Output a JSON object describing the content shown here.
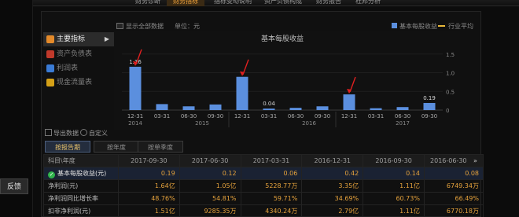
{
  "topnav": {
    "items": [
      "财务诊断",
      "财务指标",
      "指标变动说明",
      "资产负债构成",
      "财务报告",
      "杜邦分析"
    ],
    "active_index": 1
  },
  "feedback_label": "反馈",
  "sidebar": {
    "items": [
      {
        "label": "主要指标",
        "icon": "gear-icon",
        "color": "#e48a2a"
      },
      {
        "label": "资产负债表",
        "icon": "table-icon",
        "color": "#c0392b"
      },
      {
        "label": "利润表",
        "icon": "pie-icon",
        "color": "#3a7bd5"
      },
      {
        "label": "现金流量表",
        "icon": "cash-icon",
        "color": "#d4a017"
      }
    ],
    "active_index": 0
  },
  "chart_header": {
    "show_all": "显示全部数据",
    "unit": "单位：元",
    "legend_bar": "基本每股收益",
    "legend_line": "行业平均"
  },
  "chart_data": {
    "type": "bar",
    "title": "基本每股收益",
    "categories": [
      "12-31",
      "03-31",
      "06-30",
      "09-30",
      "12-31",
      "03-31",
      "06-30",
      "09-30",
      "12-31",
      "03-31",
      "06-30",
      "09-30"
    ],
    "year_labels": [
      {
        "label": "2014",
        "col": 0
      },
      {
        "label": "2015",
        "col": 2.5
      },
      {
        "label": "2016",
        "col": 6.5
      },
      {
        "label": "2017",
        "col": 10
      }
    ],
    "values": [
      1.16,
      0.16,
      0.1,
      0.15,
      0.89,
      0.04,
      0.06,
      0.1,
      0.42,
      0.05,
      0.08,
      0.19
    ],
    "data_labels": {
      "0": "1.16",
      "5": "0.04",
      "11": "0.19"
    },
    "ylim": [
      0,
      1.6
    ],
    "yticks": [
      "0",
      "0.5",
      "1.0",
      "1.5"
    ],
    "bar_color": "#5b8fde"
  },
  "tools": {
    "export": "导出数据",
    "custom": "自定义"
  },
  "tabs": [
    "按报告期",
    "按年度",
    "按单季度"
  ],
  "active_tab": 0,
  "table": {
    "header": [
      "科目\\年度",
      "2017-09-30",
      "2017-06-30",
      "2017-03-31",
      "2016-12-31",
      "2016-09-30",
      "2016-06-30"
    ],
    "more": "»",
    "rows": [
      {
        "label": "基本每股收益(元)",
        "values": [
          "0.19",
          "0.12",
          "0.06",
          "0.42",
          "0.14",
          "0.08"
        ]
      },
      {
        "label": "净利润(元)",
        "values": [
          "1.64亿",
          "1.05亿",
          "5228.77万",
          "3.35亿",
          "1.11亿",
          "6749.34万"
        ]
      },
      {
        "label": "净利润同比增长率",
        "values": [
          "48.76%",
          "54.81%",
          "59.71%",
          "34.69%",
          "60.73%",
          "66.49%"
        ]
      },
      {
        "label": "扣非净利润(元)",
        "values": [
          "1.51亿",
          "9285.35万",
          "4340.24万",
          "2.79亿",
          "1.11亿",
          "6770.18万"
        ]
      }
    ]
  }
}
